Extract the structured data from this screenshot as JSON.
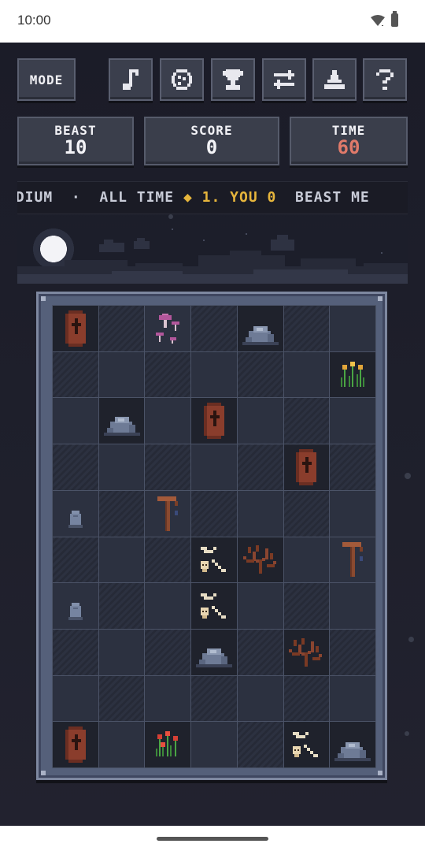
{
  "status_bar": {
    "time": "10:00"
  },
  "toolbar": {
    "mode_label": "MODE",
    "icon_buttons": [
      "music-icon",
      "palette-icon",
      "trophy-icon",
      "swap-icon",
      "podium-icon",
      "help-icon"
    ],
    "icon_glyphs": [
      "♪",
      "☺",
      "🏆",
      "⇄",
      "▲",
      "?"
    ]
  },
  "stats": {
    "beast_label": "BEAST",
    "beast_value": "10",
    "score_label": "SCORE",
    "score_value": "0",
    "time_label": "TIME",
    "time_value": "60"
  },
  "ticker": {
    "difficulty_fragment": "EDIUM",
    "sep": "·",
    "scope": "ALL TIME",
    "rank": "1. YOU",
    "rank_score": "0",
    "tail": "BEAST",
    "tail_fragment": "ME"
  },
  "board": {
    "columns": 7,
    "rows": 10,
    "cells": [
      [
        "coffin",
        "hatch",
        "mushroom",
        "hatch",
        "rock",
        "hatch",
        "plain"
      ],
      [
        "hatch",
        "plain",
        "hatch",
        "plain",
        "hatch",
        "plain",
        "flowers-yellow"
      ],
      [
        "plain",
        "rock",
        "plain",
        "coffin",
        "plain",
        "hatch",
        "plain"
      ],
      [
        "hatch",
        "plain",
        "hatch",
        "plain",
        "hatch",
        "coffin",
        "hatch"
      ],
      [
        "gravestone",
        "hatch",
        "scythe",
        "hatch",
        "plain",
        "hatch",
        "plain"
      ],
      [
        "hatch",
        "plain",
        "hatch",
        "bones",
        "dead-bush",
        "plain",
        "scythe"
      ],
      [
        "gravestone",
        "hatch",
        "plain",
        "bones",
        "plain",
        "hatch",
        "plain"
      ],
      [
        "hatch",
        "plain",
        "hatch",
        "rock",
        "hatch",
        "dead-bush",
        "hatch"
      ],
      [
        "plain",
        "hatch",
        "plain",
        "hatch",
        "plain",
        "hatch",
        "plain"
      ],
      [
        "coffin",
        "plain",
        "flowers-red",
        "plain",
        "hatch",
        "bones",
        "rock"
      ]
    ]
  },
  "colors": {
    "background": "#1c1d29",
    "time_accent": "#e07a6a",
    "ticker_gold": "#e6b53c"
  }
}
